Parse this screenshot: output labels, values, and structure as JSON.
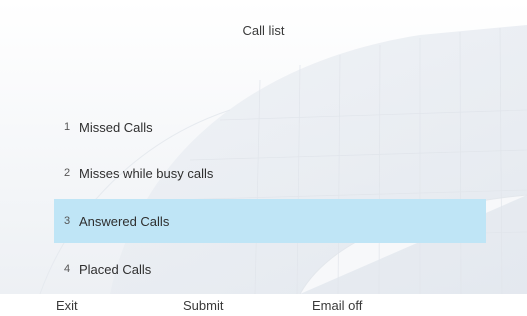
{
  "header": {
    "title": "Call list"
  },
  "call_list": {
    "items": [
      {
        "number": "1",
        "label": "Missed Calls",
        "selected": false
      },
      {
        "number": "2",
        "label": "Misses while busy calls",
        "selected": false
      },
      {
        "number": "3",
        "label": "Answered Calls",
        "selected": true
      },
      {
        "number": "4",
        "label": "Placed Calls",
        "selected": false
      }
    ]
  },
  "softkeys": {
    "exit_label": "Exit",
    "submit_label": "Submit",
    "email_label": "Email off"
  },
  "colors": {
    "selection": "#bfe5f6",
    "text": "#2f2f2f"
  }
}
